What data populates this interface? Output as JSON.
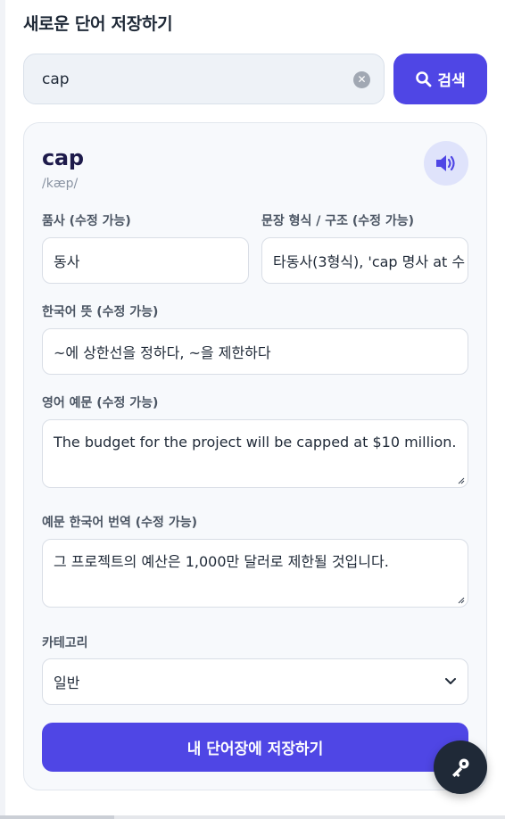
{
  "header": {
    "title": "새로운 단어 저장하기"
  },
  "search": {
    "value": "cap",
    "button_label": "검색",
    "clear_icon": "x-circle-icon",
    "search_icon": "magnifier-icon"
  },
  "word": {
    "headword": "cap",
    "phonetic": "/kæp/",
    "speaker_icon": "speaker-icon"
  },
  "form": {
    "pos_label": "품사 (수정 가능)",
    "pos_value": "동사",
    "structure_label": "문장 형식 / 구조 (수정 가능)",
    "structure_value": "타동사(3형식), 'cap 명사 at 수",
    "meaning_label": "한국어 뜻 (수정 가능)",
    "meaning_value": "~에 상한선을 정하다, ~을 제한하다",
    "example_label": "영어 예문 (수정 가능)",
    "example_value": "The budget for the project will be capped at $10 million.",
    "translation_label": "예문 한국어 번역 (수정 가능)",
    "translation_value": "그 프로젝트의 예산은 1,000만 달러로 제한될 것입니다.",
    "category_label": "카테고리",
    "category_value": "일반",
    "save_label": "내 단어장에 저장하기"
  },
  "fab": {
    "icon": "key-icon"
  },
  "colors": {
    "accent": "#4f46e5",
    "word_title": "#1e1b4b",
    "fab_bg": "#1f2937"
  }
}
